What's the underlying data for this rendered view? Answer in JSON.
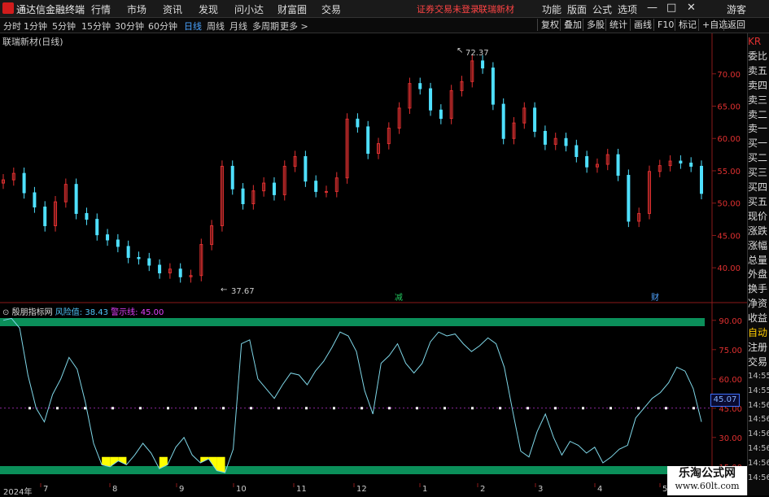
{
  "app": {
    "title": "通达信金融终端",
    "notice": "证券交易未登录",
    "stock_link": "联瑞新材"
  },
  "menu": [
    "行情",
    "市场",
    "资讯",
    "发现",
    "问小达",
    "财富圈",
    "交易"
  ],
  "right_menu": [
    "功能",
    "版面",
    "公式",
    "选项"
  ],
  "window": {
    "guest": "游客",
    "minimize": "—",
    "maximize": "□",
    "close": "✕"
  },
  "periods": [
    "分时",
    "1分钟",
    "5分钟",
    "15分钟",
    "30分钟",
    "60分钟",
    "日线",
    "周线",
    "月线",
    "多周期",
    "更多 >"
  ],
  "active_period": "日线",
  "tools": [
    "复权",
    "叠加",
    "多股",
    "统计",
    "画线",
    "F10",
    "标记",
    "+自选",
    "返回"
  ],
  "chart": {
    "title": "联瑞新材(日线)",
    "high_label": "72.37",
    "low_label": "37.67",
    "marker_jian": "减",
    "marker_cai": "财"
  },
  "side_panel": [
    "KR",
    "委比",
    "卖五",
    "卖四",
    "卖三",
    "卖二",
    "卖一",
    "买一",
    "买二",
    "买三",
    "买四",
    "买五",
    "现价",
    "涨跌",
    "涨幅",
    "总量",
    "外盘",
    "换手",
    "净资",
    "收益",
    "自动",
    "注册",
    "交易",
    "14:55",
    "14:55",
    "14:56",
    "14:56",
    "14:56",
    "14:56",
    "14:56",
    "14:56"
  ],
  "indicator": {
    "name": "殷朋指标网",
    "risk_label": "风险值:",
    "risk_value": "38.43",
    "warn_label": "警示线:",
    "warn_value": "45.00",
    "current_value": "45.07"
  },
  "x_axis": [
    "2024年",
    "7",
    "8",
    "9",
    "10",
    "11",
    "12",
    "1",
    "2",
    "3",
    "4",
    "5"
  ],
  "watermark": {
    "line1": "乐淘公式网",
    "line2": "www.60lt.com"
  },
  "colors": {
    "up": "#e03030",
    "down": "#4fe0ff",
    "band": "#0b8f5a",
    "fill": "#ffff00",
    "line": "#7fd7e8"
  },
  "chart_data": [
    {
      "type": "candlestick",
      "title": "联瑞新材(日线)",
      "yticks": [
        40.0,
        45.0,
        50.0,
        55.0,
        60.0,
        65.0,
        70.0
      ],
      "ylim": [
        36.5,
        74.5
      ],
      "series": [
        {
          "values": [
            53.6,
            54.6,
            51.6,
            49.4,
            46.5,
            50.2,
            52.9,
            48.4,
            47.5,
            45.1,
            44.3,
            43.3,
            41.6,
            41.4,
            40.4,
            39.2,
            39.8,
            38.6,
            38.8,
            43.6,
            46.5,
            55.7,
            52.2,
            49.9,
            51.9,
            53.1,
            51.3,
            55.7,
            57.2,
            53.4,
            51.8,
            51.8,
            53.9,
            63.0,
            61.8,
            57.7,
            59.2,
            61.6,
            64.7,
            68.5,
            67.7,
            64.4,
            63.1,
            67.4,
            68.8,
            72.0,
            70.9,
            65.3,
            60.0,
            62.4,
            64.7,
            61.1,
            59.1,
            60.0,
            58.9,
            57.2,
            55.6,
            56.0,
            57.5,
            54.3,
            47.2,
            48.4,
            54.9,
            55.8,
            56.5,
            56.2,
            55.7,
            51.5
          ]
        }
      ]
    },
    {
      "type": "line",
      "title": "殷朋指标网",
      "yticks": [
        15.0,
        30.0,
        45.0,
        60.0,
        75.0,
        90.0
      ],
      "ylim": [
        12.0,
        97.0
      ],
      "series": [
        {
          "name": "风险值",
          "values": [
            90,
            91,
            86,
            62,
            45,
            38,
            52,
            60,
            71,
            65,
            48,
            27,
            16,
            15,
            18,
            16,
            21,
            27,
            22,
            14,
            16,
            25,
            30,
            21,
            17,
            19,
            13,
            12,
            24,
            78,
            80,
            60,
            55,
            50,
            57,
            63,
            62,
            57,
            64,
            69,
            76,
            84,
            82,
            74,
            54,
            42,
            68,
            72,
            78,
            68,
            63,
            68,
            79,
            84,
            82,
            83,
            78,
            74,
            77,
            81,
            78,
            66,
            44,
            23,
            20,
            33,
            42,
            30,
            21,
            28,
            26,
            22,
            25,
            17,
            20,
            24,
            26,
            40,
            45,
            50,
            53,
            58,
            66,
            64,
            55,
            38
          ]
        },
        {
          "name": "警示线",
          "values": [
            45
          ]
        }
      ]
    }
  ]
}
